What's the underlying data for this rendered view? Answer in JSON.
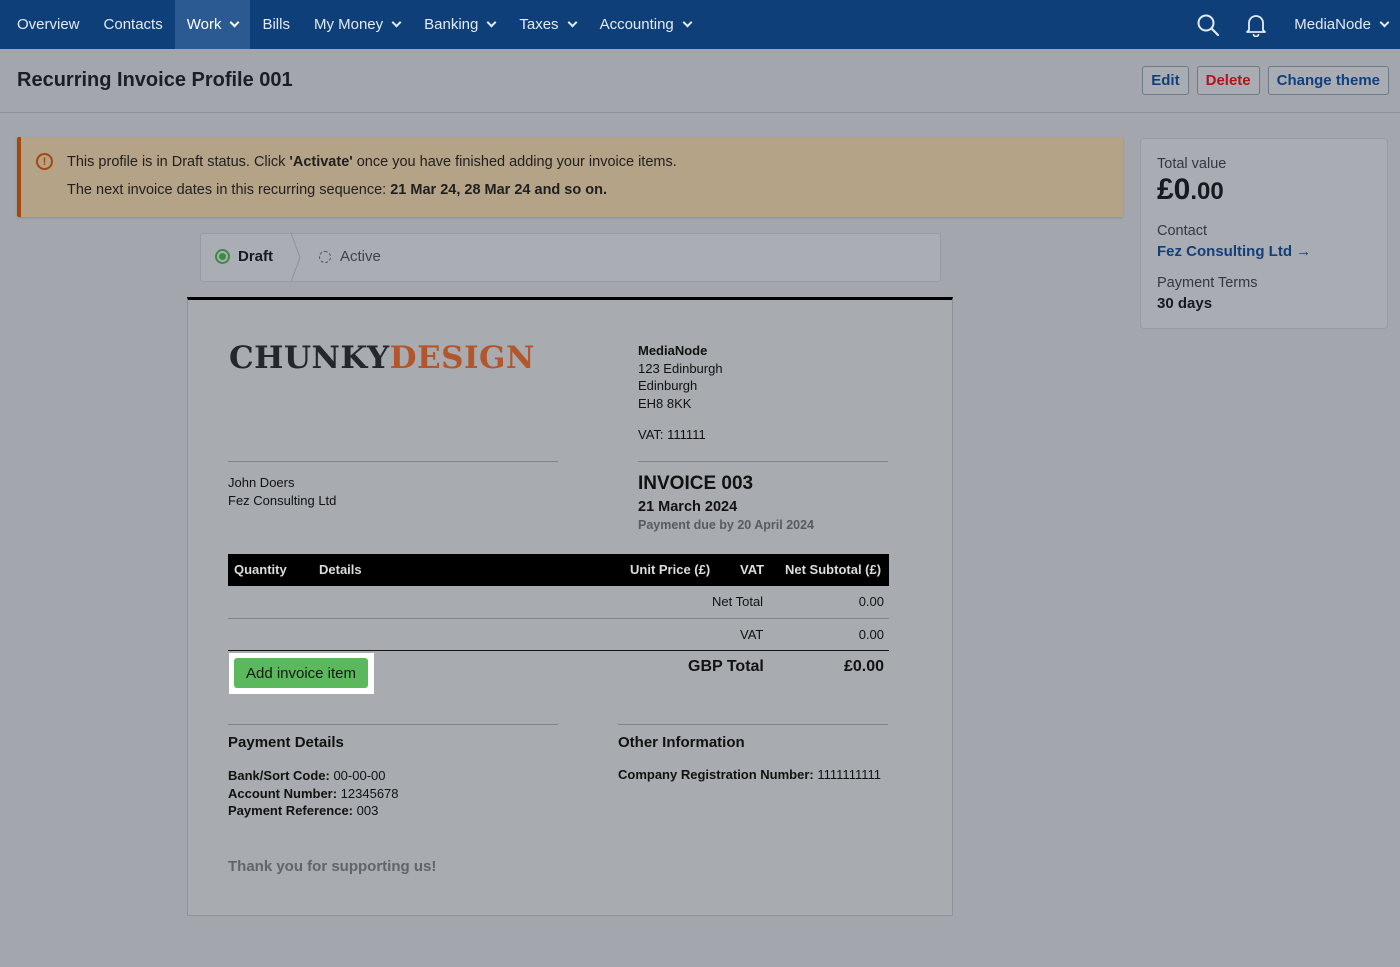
{
  "nav": {
    "items": [
      {
        "label": "Overview",
        "dropdown": false,
        "active": false
      },
      {
        "label": "Contacts",
        "dropdown": false,
        "active": false
      },
      {
        "label": "Work",
        "dropdown": true,
        "active": true
      },
      {
        "label": "Bills",
        "dropdown": false,
        "active": false
      },
      {
        "label": "My Money",
        "dropdown": true,
        "active": false
      },
      {
        "label": "Banking",
        "dropdown": true,
        "active": false
      },
      {
        "label": "Taxes",
        "dropdown": true,
        "active": false
      },
      {
        "label": "Accounting",
        "dropdown": true,
        "active": false
      }
    ],
    "account": "MediaNode",
    "icons": [
      "search-icon",
      "bell-icon"
    ]
  },
  "header": {
    "title": "Recurring Invoice Profile 001",
    "buttons": {
      "edit": "Edit",
      "delete": "Delete",
      "change_theme": "Change theme"
    }
  },
  "alert": {
    "line1_pre": "This profile is in Draft status. Click ",
    "line1_bold": "'Activate'",
    "line1_post": " once you have finished adding your invoice items.",
    "line2_pre": "The next invoice dates in this recurring sequence: ",
    "line2_bold": "21 Mar 24, 28 Mar 24 and so on."
  },
  "summary": {
    "total_label": "Total value",
    "total_major": "£0",
    "total_minor": ".00",
    "contact_label": "Contact",
    "contact_name": "Fez Consulting Ltd →",
    "terms_label": "Payment Terms",
    "terms_value": "30 days"
  },
  "status_steps": {
    "draft": "Draft",
    "active": "Active",
    "current": "Draft"
  },
  "invoice": {
    "logo_part1": "CHUNKY",
    "logo_part2": "DESIGN",
    "from": {
      "name": "MediaNode",
      "address1": "123 Edinburgh",
      "address2": "Edinburgh",
      "postcode": "EH8 8KK",
      "vat": "VAT: 111111"
    },
    "to": {
      "person": "John Doers",
      "company": "Fez Consulting Ltd"
    },
    "number": "INVOICE 003",
    "date": "21 March 2024",
    "due": "Payment due by 20 April 2024",
    "table": {
      "headers": {
        "quantity": "Quantity",
        "details": "Details",
        "unit_price": "Unit Price (£)",
        "vat": "VAT",
        "net_subtotal": "Net Subtotal (£)"
      },
      "net_total_label": "Net Total",
      "net_total_value": "0.00",
      "vat_label": "VAT",
      "vat_value": "0.00",
      "gbp_total_label": "GBP Total",
      "gbp_total_value": "£0.00"
    },
    "add_item_label": "Add invoice item",
    "payment_details": {
      "title": "Payment Details",
      "sort_code_label": "Bank/Sort Code:",
      "sort_code": " 00-00-00",
      "account_label": "Account Number:",
      "account": " 12345678",
      "reference_label": "Payment Reference:",
      "reference": " 003"
    },
    "other_info": {
      "title": "Other Information",
      "reg_label": "Company Registration Number:",
      "reg_value": " 1111111111"
    },
    "thanks": "Thank you for supporting us!"
  },
  "colors": {
    "nav_bg": "#0e3f79",
    "alert_accent": "#a6470e",
    "success": "#5cb85c",
    "link": "#123f7a",
    "danger": "#b3121d",
    "logo_accent": "#b4562b"
  }
}
